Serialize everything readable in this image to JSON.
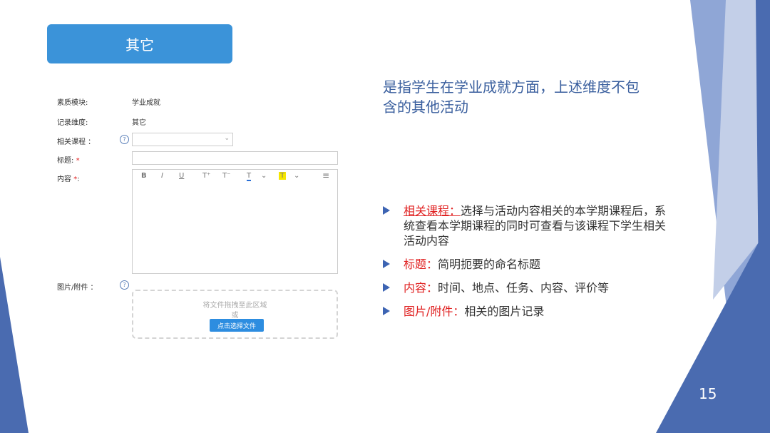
{
  "header": {
    "title": "其它"
  },
  "form": {
    "quality_module_label": "素质模块:",
    "quality_module_value": "学业成就",
    "dimension_label": "记录维度:",
    "dimension_value": "其它",
    "course_label": "相关课程 ：",
    "help_glyph": "?",
    "title_label": "标题:",
    "required_mark": "*",
    "content_label": "内容",
    "content_suffix": ":",
    "attachment_label": "图片/附件 ：",
    "drop_text": "将文件拖拽至此区域",
    "drop_or": "或",
    "choose_file_label": "点击选择文件"
  },
  "toolbar": {
    "bold": "B",
    "italic": "I",
    "underline": "U",
    "font_size_up": "T⁺",
    "font_size_down": "T⁻",
    "font_color": "T",
    "highlight": "T",
    "align": "≡"
  },
  "description": "是指学生在学业成就方面，上述维度不包含的其他活动",
  "bullets": [
    {
      "key": "相关课程：",
      "text": "选择与活动内容相关的本学期课程后，系统查看本学期课程的同时可查看与该课程下学生相关活动内容"
    },
    {
      "key": "标题：",
      "text": "简明扼要的命名标题"
    },
    {
      "key": "内容：",
      "text": "时间、地点、任务、内容、评价等"
    },
    {
      "key": "图片/附件：",
      "text": "相关的图片记录"
    }
  ],
  "page_number": "15",
  "colors": {
    "accent": "#3b93d9",
    "deco_dark": "#4a6bb0",
    "deco_light": "#8fa6d6",
    "deco_pale": "#c3cfe8"
  }
}
